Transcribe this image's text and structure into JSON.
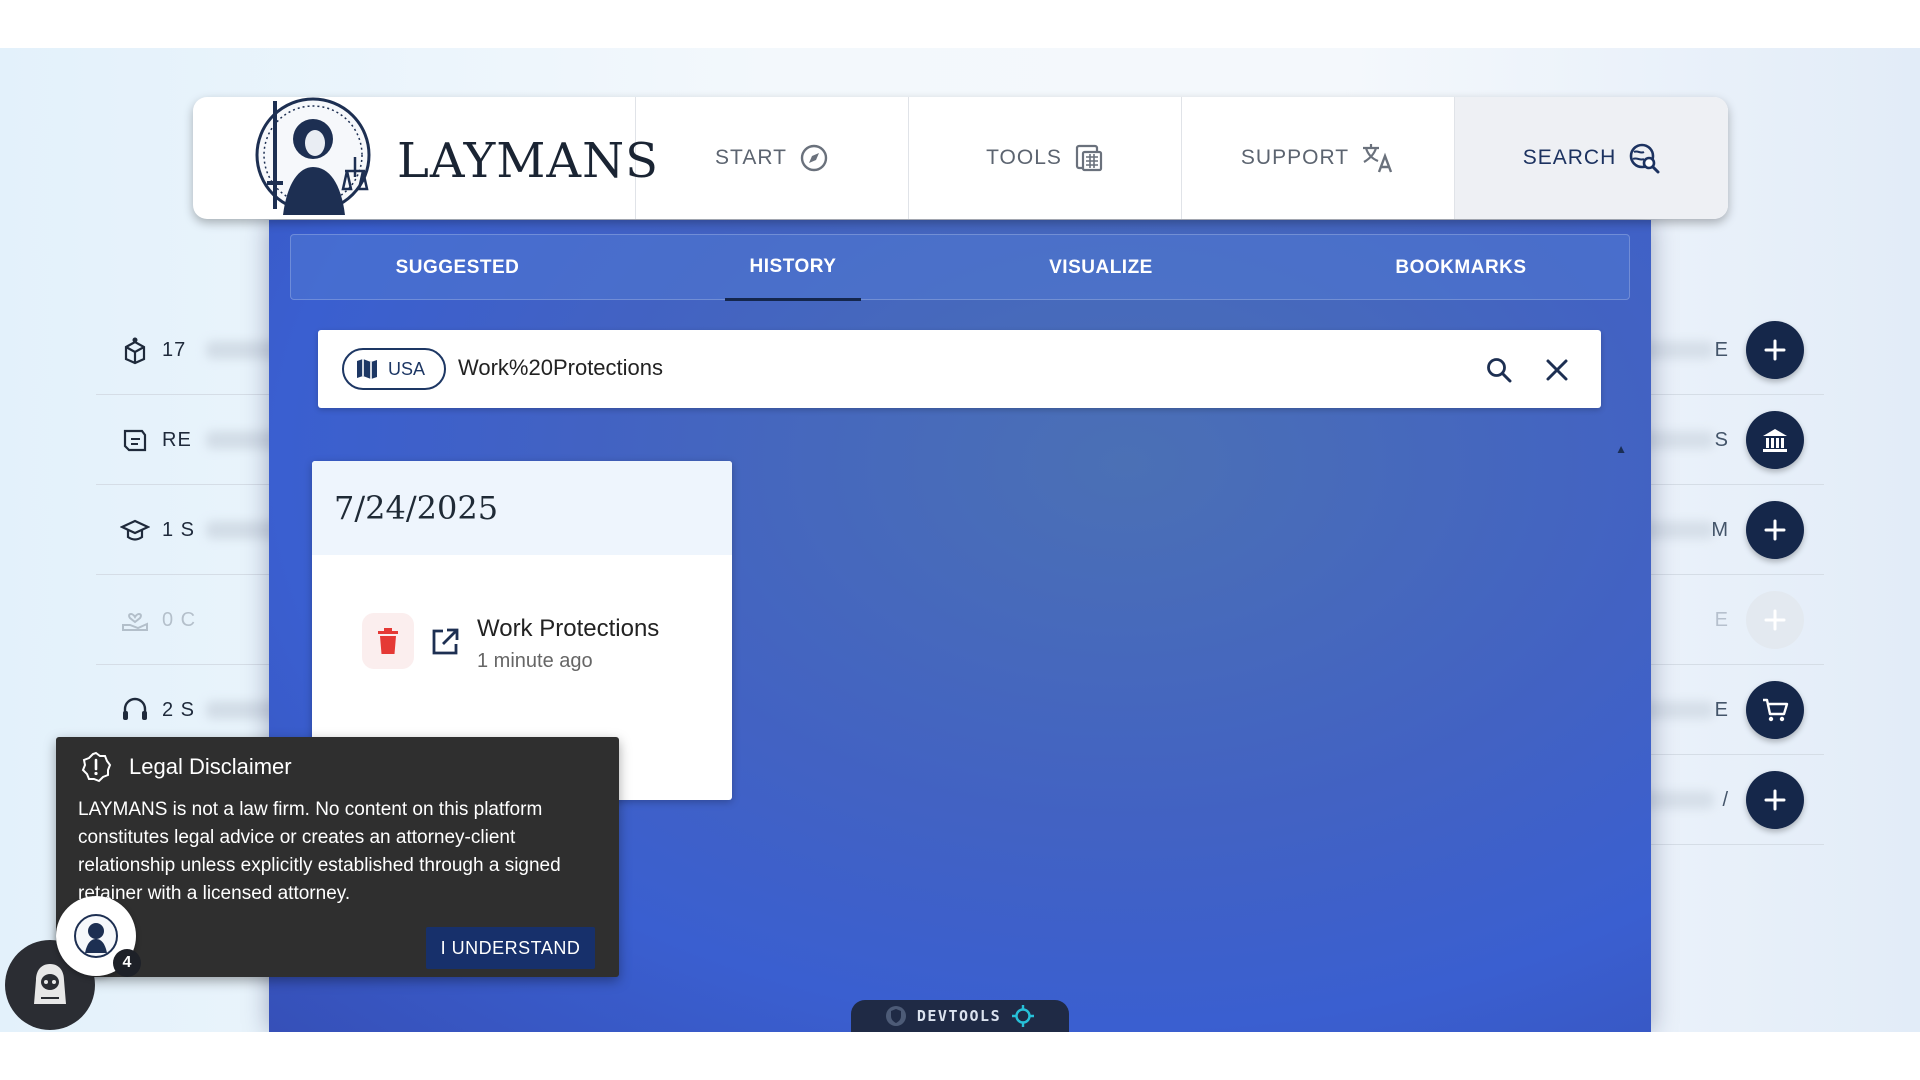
{
  "brand": {
    "name": "LAYMANS",
    "logo_icon": "lady-justice-seal"
  },
  "nav": [
    {
      "label": "START",
      "icon": "compass-icon"
    },
    {
      "label": "TOOLS",
      "icon": "calculator-icon"
    },
    {
      "label": "SUPPORT",
      "icon": "translate-icon"
    },
    {
      "label": "SEARCH",
      "icon": "search-globe-icon",
      "active": true
    }
  ],
  "tabs": [
    {
      "label": "SUGGESTED"
    },
    {
      "label": "HISTORY",
      "active": true
    },
    {
      "label": "VISUALIZE"
    },
    {
      "label": "BOOKMARKS"
    }
  ],
  "search": {
    "jurisdiction": "USA",
    "query": "Work%20Protections"
  },
  "history": {
    "date": "7/24/2025",
    "items": [
      {
        "title": "Work Protections",
        "time": "1 minute ago"
      }
    ]
  },
  "side_list": [
    {
      "label": "17",
      "icon": "box-hand-icon",
      "right_glyph": "E",
      "action": "plus-icon"
    },
    {
      "label": "RE",
      "icon": "signed-doc-icon",
      "right_glyph": "S",
      "action": "bank-icon"
    },
    {
      "label": "1 S",
      "icon": "graduation-cap-icon",
      "right_glyph": "M",
      "action": "plus-icon"
    },
    {
      "label": "0 C",
      "icon": "hand-heart-icon",
      "right_glyph": "E",
      "action": "plus-icon",
      "disabled": true
    },
    {
      "label": "2 S",
      "icon": "headset-icon",
      "right_glyph": "E",
      "action": "cart-icon"
    },
    {
      "label": "",
      "icon": "",
      "right_glyph": "/",
      "action": "plus-icon"
    }
  ],
  "disclaimer": {
    "title": "Legal Disclaimer",
    "body": "LAYMANS is not a law firm. No content on this platform constitutes legal advice or creates an attorney-client relationship unless explicitly established through a signed retainer with a licensed attorney.",
    "button": "I UNDERSTAND"
  },
  "devtools": {
    "label": "DEVTOOLS"
  },
  "assistant": {
    "badge_count": "4"
  },
  "colors": {
    "navy": "#15274a",
    "panel_blue": "#4262c3",
    "delete_red": "#e53935"
  }
}
